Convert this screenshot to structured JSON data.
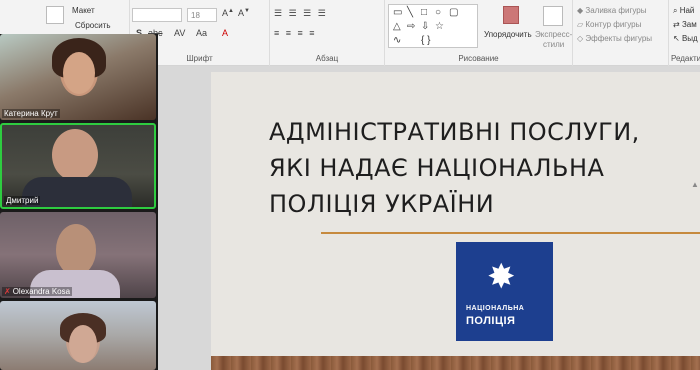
{
  "ribbon": {
    "layout_label": "Макет",
    "reset_label": "Сбросить",
    "font_size": "18",
    "font_group_label": "Шрифт",
    "paragraph_group_label": "Абзац",
    "drawing_group_label": "Рисование",
    "editing_group_label": "Редакти",
    "arrange_label": "Упорядочить",
    "quick_styles_label_1": "Экспресс-",
    "quick_styles_label_2": "стили",
    "shape_fill_label": "Заливка фигуры",
    "shape_outline_label": "Контур фигуры",
    "shape_effects_label": "Эффекты фигуры",
    "find_label": "Най",
    "replace_label": "Зам",
    "select_label": "Выд"
  },
  "participants": [
    {
      "name": "Катерина Крут",
      "muted": false
    },
    {
      "name": "Дмитрий",
      "muted": false,
      "active_speaker": true
    },
    {
      "name": "Olexandra Kosa",
      "muted": true
    },
    {
      "name": "",
      "muted": false
    }
  ],
  "slide": {
    "title_line1": "АДМІНІСТРАТИВНІ ПОСЛУГИ,",
    "title_line2": "ЯКІ НАДАЄ НАЦІОНАЛЬНА",
    "title_line3": "ПОЛІЦІЯ УКРАЇНИ",
    "logo_line1": "НАЦІОНАЛЬНА",
    "logo_line2": "ПОЛІЦІЯ",
    "accent_color": "#c68a3e",
    "logo_color": "#1d3f8f"
  }
}
